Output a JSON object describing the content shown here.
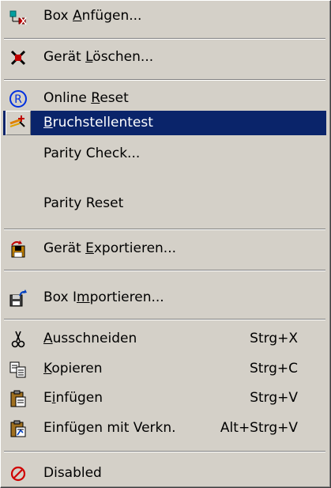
{
  "menu": {
    "items": [
      {
        "pre": "Box ",
        "key": "A",
        "post": "nfügen...",
        "icon": "add-box-icon"
      },
      {
        "pre": "Gerät ",
        "key": "L",
        "post": "öschen...",
        "icon": "delete-device-icon"
      },
      {
        "pre": "Online ",
        "key": "R",
        "post": "eset",
        "icon": "online-reset-icon"
      },
      {
        "pre": "",
        "key": "B",
        "post": "ruchstellentest",
        "icon": "magic-wand-icon"
      },
      {
        "label": "Parity Check..."
      },
      {
        "label": "Parity Reset"
      },
      {
        "pre": "Gerät ",
        "key": "E",
        "post": "xportieren...",
        "icon": "export-device-icon"
      },
      {
        "pre": "Box I",
        "key": "m",
        "post": "portieren...",
        "icon": "import-box-icon"
      },
      {
        "pre": "",
        "key": "A",
        "post": "usschneiden",
        "shortcut": "Strg+X",
        "icon": "scissors-icon"
      },
      {
        "pre": "",
        "key": "K",
        "post": "opieren",
        "shortcut": "Strg+C",
        "icon": "copy-icon"
      },
      {
        "pre": "E",
        "key": "i",
        "post": "nfügen",
        "shortcut": "Strg+V",
        "icon": "paste-icon"
      },
      {
        "label": "Einfügen mit Verkn.",
        "shortcut": "Alt+Strg+V",
        "icon": "paste-link-icon"
      },
      {
        "label": "Disabled",
        "icon": "disabled-icon"
      }
    ]
  },
  "colors": {
    "menu_bg": "#d4d0c8",
    "highlight": "#0a246a"
  }
}
